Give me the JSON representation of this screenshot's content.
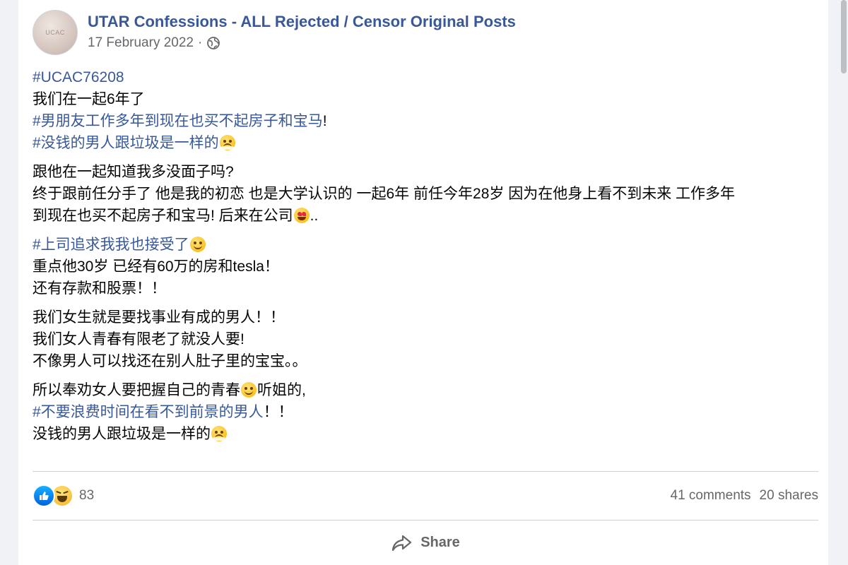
{
  "post": {
    "page_name": "UTAR Confessions - ALL Rejected / Censor Original Posts",
    "avatar_label": "UCAC",
    "date": "17 February 2022",
    "separator": "·"
  },
  "body": {
    "p1": {
      "l1": "#UCAC76208",
      "l2": "我们在一起6年了",
      "l3": "#男朋友工作多年到现在也买不起房子和宝马",
      "l3_tail": "!",
      "l4": "#没钱的男人跟垃圾是一样的"
    },
    "p2": {
      "l1": "跟他在一起知道我多没面子吗?",
      "l2": "终于跟前任分手了 他是我的初恋 也是大学认识的 一起6年 前任今年28岁 因为在他身上看不到未来 工作多年",
      "l3": "到现在也买不起房子和宝马! 后来在公司",
      "l3_tail": ".."
    },
    "p3": {
      "l1": "#上司追求我我也接受了",
      "l2": "重点他30岁 已经有60万的房和tesla！",
      "l3": "还有存款和股票！！"
    },
    "p4": {
      "l1": "我们女生就是要找事业有成的男人！！",
      "l2": "我们女人青春有限老了就没人要!",
      "l3": "不像男人可以找还在别人肚子里的宝宝。。"
    },
    "p5": {
      "l1a": "所以奉劝女人要把握自己的青春",
      "l1b": "听姐的,",
      "l2": "#不要浪费时间在看不到前景的男人",
      "l2_tail": "！！",
      "l3": "没钱的男人跟垃圾是一样的"
    }
  },
  "stats": {
    "reaction_count": "83",
    "comments": "41 comments",
    "shares": "20 shares"
  },
  "actions": {
    "share_label": "Share"
  },
  "icons": {
    "emoji_steam": "face-with-steam-from-nose",
    "emoji_heart_eyes": "smiling-face-with-heart-eyes",
    "emoji_blush": "smiling-face-with-smiling-eyes",
    "like": "like-reaction",
    "haha": "haha-reaction"
  }
}
